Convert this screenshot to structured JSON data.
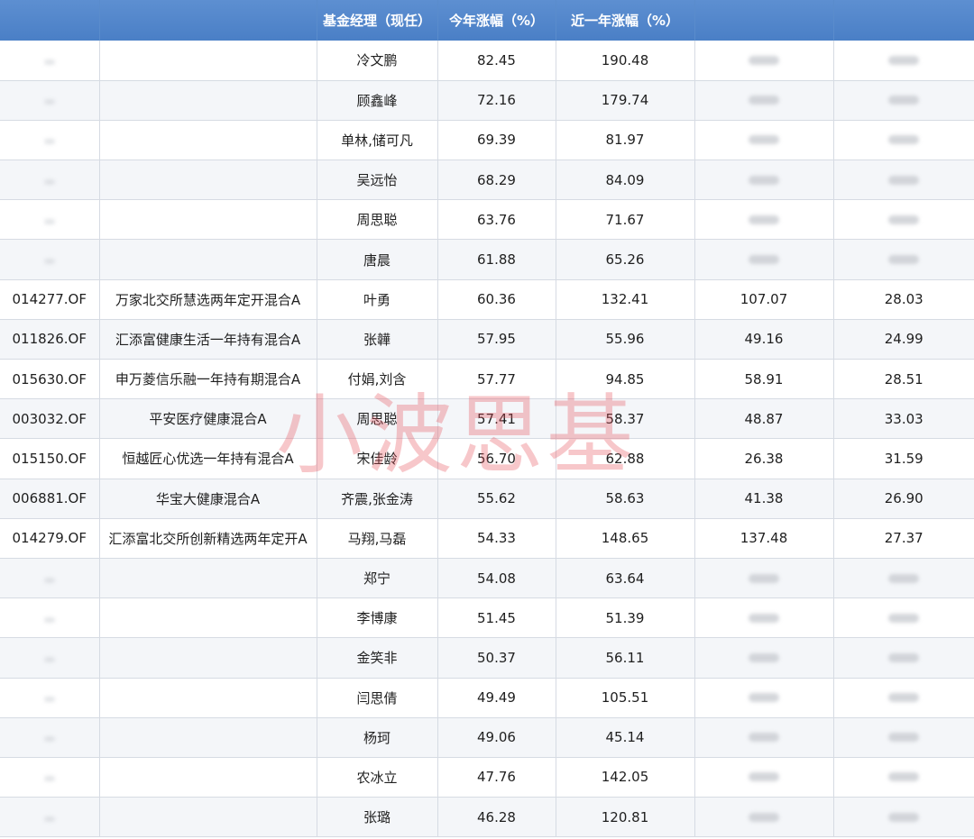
{
  "headers": [
    "",
    "",
    "基金经理（现任）",
    "今年涨幅（%）",
    "近一年涨幅（%）",
    "",
    ""
  ],
  "rows": [
    {
      "code": "",
      "name": "",
      "manager": "冷文鹏",
      "ytd": "82.45",
      "one_year": "190.48",
      "c5": "",
      "c6": ""
    },
    {
      "code": "",
      "name": "",
      "manager": "顾鑫峰",
      "ytd": "72.16",
      "one_year": "179.74",
      "c5": "",
      "c6": ""
    },
    {
      "code": "",
      "name": "",
      "manager": "单林,储可凡",
      "ytd": "69.39",
      "one_year": "81.97",
      "c5": "",
      "c6": ""
    },
    {
      "code": "",
      "name": "",
      "manager": "吴远怡",
      "ytd": "68.29",
      "one_year": "84.09",
      "c5": "",
      "c6": ""
    },
    {
      "code": "",
      "name": "",
      "manager": "周思聪",
      "ytd": "63.76",
      "one_year": "71.67",
      "c5": "",
      "c6": ""
    },
    {
      "code": "",
      "name": "",
      "manager": "唐晨",
      "ytd": "61.88",
      "one_year": "65.26",
      "c5": "",
      "c6": ""
    },
    {
      "code": "014277.OF",
      "name": "万家北交所慧选两年定开混合A",
      "manager": "叶勇",
      "ytd": "60.36",
      "one_year": "132.41",
      "c5": "107.07",
      "c6": "28.03"
    },
    {
      "code": "011826.OF",
      "name": "汇添富健康生活一年持有混合A",
      "manager": "张韡",
      "ytd": "57.95",
      "one_year": "55.96",
      "c5": "49.16",
      "c6": "24.99"
    },
    {
      "code": "015630.OF",
      "name": "申万菱信乐融一年持有期混合A",
      "manager": "付娟,刘含",
      "ytd": "57.77",
      "one_year": "94.85",
      "c5": "58.91",
      "c6": "28.51"
    },
    {
      "code": "003032.OF",
      "name": "平安医疗健康混合A",
      "manager": "周思聪",
      "ytd": "57.41",
      "one_year": "58.37",
      "c5": "48.87",
      "c6": "33.03"
    },
    {
      "code": "015150.OF",
      "name": "恒越匠心优选一年持有混合A",
      "manager": "宋佳龄",
      "ytd": "56.70",
      "one_year": "62.88",
      "c5": "26.38",
      "c6": "31.59"
    },
    {
      "code": "006881.OF",
      "name": "华宝大健康混合A",
      "manager": "齐震,张金涛",
      "ytd": "55.62",
      "one_year": "58.63",
      "c5": "41.38",
      "c6": "26.90"
    },
    {
      "code": "014279.OF",
      "name": "汇添富北交所创新精选两年定开A",
      "manager": "马翔,马磊",
      "ytd": "54.33",
      "one_year": "148.65",
      "c5": "137.48",
      "c6": "27.37"
    },
    {
      "code": "",
      "name": "",
      "manager": "郑宁",
      "ytd": "54.08",
      "one_year": "63.64",
      "c5": "",
      "c6": ""
    },
    {
      "code": "",
      "name": "",
      "manager": "李博康",
      "ytd": "51.45",
      "one_year": "51.39",
      "c5": "",
      "c6": ""
    },
    {
      "code": "",
      "name": "",
      "manager": "金笑非",
      "ytd": "50.37",
      "one_year": "56.11",
      "c5": "",
      "c6": ""
    },
    {
      "code": "",
      "name": "",
      "manager": "闫思倩",
      "ytd": "49.49",
      "one_year": "105.51",
      "c5": "",
      "c6": ""
    },
    {
      "code": "",
      "name": "",
      "manager": "杨珂",
      "ytd": "49.06",
      "one_year": "45.14",
      "c5": "",
      "c6": ""
    },
    {
      "code": "",
      "name": "",
      "manager": "农冰立",
      "ytd": "47.76",
      "one_year": "142.05",
      "c5": "",
      "c6": ""
    },
    {
      "code": "",
      "name": "",
      "manager": "张璐",
      "ytd": "46.28",
      "one_year": "120.81",
      "c5": "",
      "c6": ""
    }
  ],
  "watermark": "小波思基",
  "colors": {
    "header_bg": "#4f84c9",
    "header_text": "#ffffff",
    "watermark": "#e6505a"
  }
}
